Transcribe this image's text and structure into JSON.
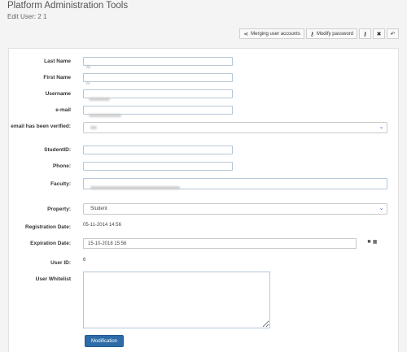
{
  "header": {
    "title": "Platform Administration Tools",
    "subtitle": "Edit User: 2 1"
  },
  "toolbar": {
    "merge_label": "Merging user accounts",
    "modify_password_label": "Modify password",
    "merge_icon": "merge-icon",
    "key_icon": "key-icon"
  },
  "form": {
    "labels": {
      "last_name": "Last Name",
      "first_name": "First Name",
      "username": "Username",
      "email": "e-mail",
      "email_verified": "email has been verified:",
      "student_id": "StudentID:",
      "phone": "Phone:",
      "faculty": "Faculty:",
      "property": "Property:",
      "registration_date": "Registration Date:",
      "expiration_date": "Expiration Date:",
      "user_id": "User ID:",
      "user_whitelist": "User Whitelist"
    },
    "values": {
      "property": "Student",
      "registration_date": "05-11-2014 14:56",
      "expiration_date": "15-10-2018 15:56",
      "user_id": "6"
    },
    "submit_label": "Modification"
  },
  "colors": {
    "primary": "#2d6ca8",
    "chevron": "#3a62a8"
  }
}
